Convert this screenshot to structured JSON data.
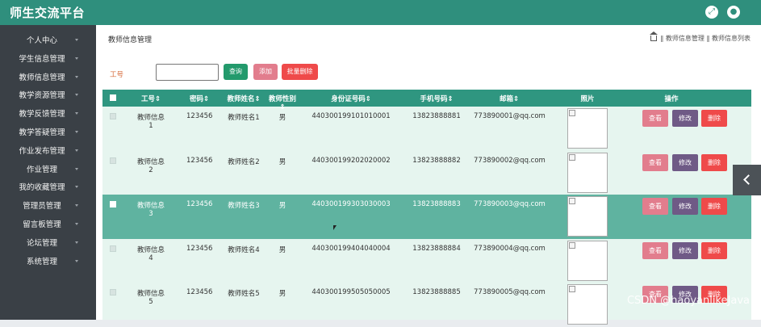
{
  "app": {
    "title": "师生交流平台"
  },
  "header": {
    "icons": [
      "fullscreen-icon",
      "user-icon"
    ]
  },
  "sidebar": {
    "items": [
      {
        "label": "个人中心"
      },
      {
        "label": "学生信息管理"
      },
      {
        "label": "教师信息管理"
      },
      {
        "label": "教学资源管理"
      },
      {
        "label": "教学反馈管理"
      },
      {
        "label": "教学答疑管理"
      },
      {
        "label": "作业发布管理"
      },
      {
        "label": "作业管理"
      },
      {
        "label": "我的收藏管理"
      },
      {
        "label": "管理员管理"
      },
      {
        "label": "留言板管理"
      },
      {
        "label": "论坛管理"
      },
      {
        "label": "系统管理"
      }
    ]
  },
  "main": {
    "heading": "教师信息管理",
    "breadcrumb": "‖ 教师信息管理 ‖ 教师信息列表"
  },
  "search": {
    "label": "工号",
    "value": "",
    "query_label": "查询",
    "add_label": "添加",
    "batch_delete_label": "批量删除"
  },
  "table": {
    "headers": [
      "工号⇕",
      "密码⇕",
      "教师姓名⇕",
      "教师性别⇕",
      "身份证号码⇕",
      "手机号码⇕",
      "邮箱⇕",
      "照片",
      "操作"
    ],
    "rows": [
      {
        "id": "教师信息1",
        "password": "123456",
        "name": "教师姓名1",
        "gender": "男",
        "id_card": "440300199101010001",
        "phone": "13823888881",
        "email": "773890001@qq.com"
      },
      {
        "id": "教师信息2",
        "password": "123456",
        "name": "教师姓名2",
        "gender": "男",
        "id_card": "440300199202020002",
        "phone": "13823888882",
        "email": "773890002@qq.com"
      },
      {
        "id": "教师信息3",
        "password": "123456",
        "name": "教师姓名3",
        "gender": "男",
        "id_card": "440300199303030003",
        "phone": "13823888883",
        "email": "773890003@qq.com"
      },
      {
        "id": "教师信息4",
        "password": "123456",
        "name": "教师姓名4",
        "gender": "男",
        "id_card": "440300199404040004",
        "phone": "13823888884",
        "email": "773890004@qq.com"
      },
      {
        "id": "教师信息5",
        "password": "123456",
        "name": "教师姓名5",
        "gender": "男",
        "id_card": "440300199505050005",
        "phone": "13823888885",
        "email": "773890005@qq.com"
      }
    ],
    "actions": {
      "view": "查看",
      "edit": "修改",
      "delete": "删除"
    },
    "highlight_row": 3
  },
  "watermark": "CSDN @haoyanlikeJava",
  "colors": {
    "topbar": "#2f8f7d",
    "sidebar": "#3a4046",
    "table_header": "#2f9680",
    "row_bg": "#e6f5ef",
    "row_hover": "#5fb3a0",
    "view_button": "#e27d8d",
    "edit_button": "#6f5a86",
    "delete_button": "#ef4a4a",
    "query_button": "#239a6c"
  }
}
